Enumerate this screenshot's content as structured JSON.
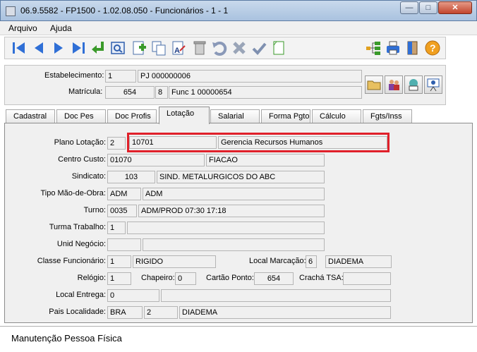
{
  "window": {
    "title": "06.9.5582 - FP1500 - 1.02.08.050 - Funcionários - 1 - 1"
  },
  "menu": {
    "items": [
      "Arquivo",
      "Ajuda"
    ]
  },
  "header": {
    "estabelecimento_label": "Estabelecimento:",
    "estabelecimento_code": "1",
    "estabelecimento_name": "PJ 000000006",
    "matricula_label": "Matrícula:",
    "matricula_value": "654",
    "matricula_digit": "8",
    "matricula_name": "Func 1  00000654"
  },
  "tabs": [
    {
      "label": "Cadastral"
    },
    {
      "label": "Doc Pes"
    },
    {
      "label": "Doc Profis"
    },
    {
      "label": "Lotação"
    },
    {
      "label": "Salarial"
    },
    {
      "label": "Forma Pgto"
    },
    {
      "label": "Cálculo"
    },
    {
      "label": "Fgts/Inss"
    }
  ],
  "form": {
    "plano_lotacao_label": "Plano Lotação:",
    "plano_lotacao_value": "2",
    "lotacao_code": "10701",
    "lotacao_name": "Gerencia Recursos Humanos",
    "centro_custo_label": "Centro Custo:",
    "centro_custo_code": "01070",
    "centro_custo_name": "FIACAO",
    "sindicato_label": "Sindicato:",
    "sindicato_code": "103",
    "sindicato_name": "SIND. METALURGICOS DO ABC",
    "tipo_mao_obra_label": "Tipo Mão-de-Obra:",
    "tipo_mao_obra_code": "ADM",
    "tipo_mao_obra_name": "ADM",
    "turno_label": "Turno:",
    "turno_code": "0035",
    "turno_name": "ADM/PROD 07:30 17:18",
    "turma_trabalho_label": "Turma Trabalho:",
    "turma_trabalho_value": "1",
    "unid_negocio_label": "Unid Negócio:",
    "classe_funcionario_label": "Classe Funcionário:",
    "classe_funcionario_code": "1",
    "classe_funcionario_name": "RIGIDO",
    "local_marcacao_label": "Local Marcação:",
    "local_marcacao_code": "6",
    "local_marcacao_name": "DIADEMA",
    "relogio_label": "Relógio:",
    "relogio_value": "1",
    "chapeiro_label": "Chapeiro:",
    "chapeiro_value": "0",
    "cartao_ponto_label": "Cartão Ponto:",
    "cartao_ponto_value": "654",
    "cracha_tsa_label": "Crachá TSA:",
    "local_entrega_label": "Local Entrega:",
    "local_entrega_value": "0",
    "pais_localidade_label": "Pais Localidade:",
    "pais_code": "BRA",
    "localidade_code": "2",
    "localidade_name": "DIADEMA"
  },
  "status": {
    "text": "Manutenção Pessoa Física"
  },
  "colors": {
    "highlight": "#e0202a",
    "toolbar_blue": "#2f6fd6",
    "help_orange": "#f0a020"
  }
}
